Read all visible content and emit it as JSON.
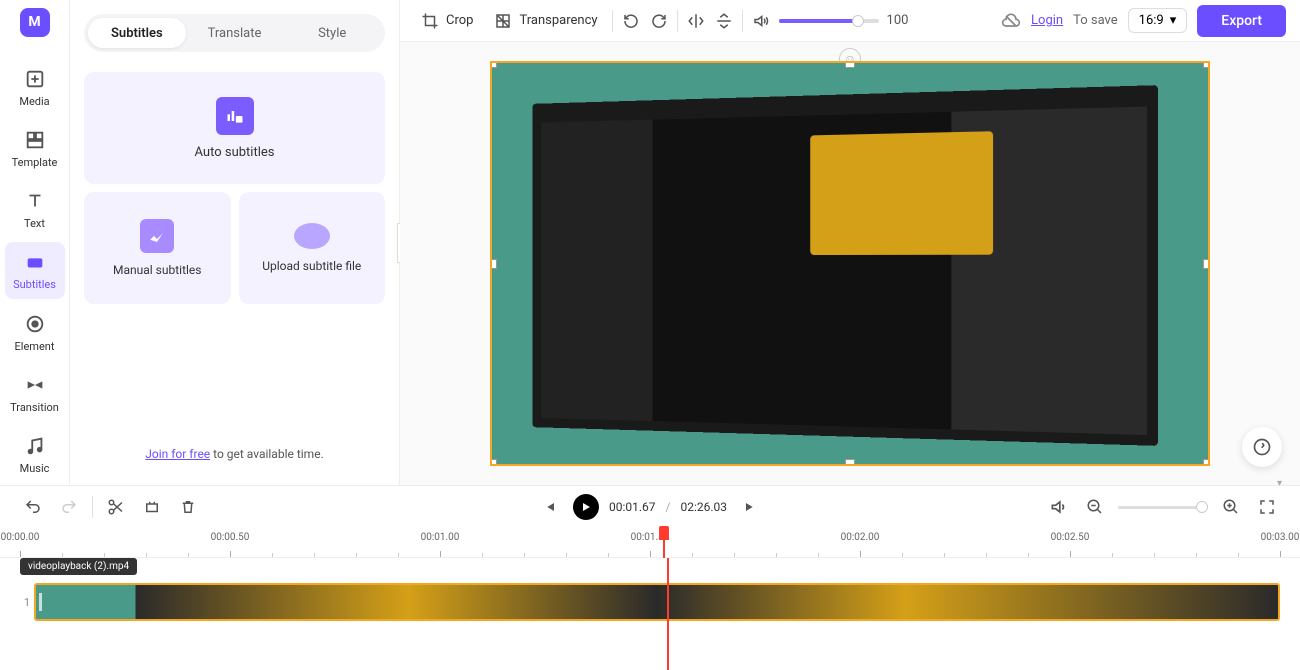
{
  "sidebar": {
    "items": [
      {
        "label": "Media"
      },
      {
        "label": "Template"
      },
      {
        "label": "Text"
      },
      {
        "label": "Subtitles"
      },
      {
        "label": "Element"
      },
      {
        "label": "Transition"
      },
      {
        "label": "Music"
      }
    ]
  },
  "panel": {
    "tabs": [
      {
        "label": "Subtitles"
      },
      {
        "label": "Translate"
      },
      {
        "label": "Style"
      }
    ],
    "auto_label": "Auto subtitles",
    "manual_label": "Manual subtitles",
    "upload_label": "Upload subtitle file",
    "join_link": "Join for free",
    "join_rest": " to get available time."
  },
  "toolbar": {
    "crop": "Crop",
    "transparency": "Transparency",
    "volume": "100",
    "login": "Login",
    "to_save": "To save",
    "ratio": "16:9",
    "export": "Export"
  },
  "playback": {
    "current": "00:01.67",
    "separator": "/",
    "total": "02:26.03"
  },
  "ruler": {
    "labels": [
      "00:00.00",
      "00:00.50",
      "00:01.00",
      "00:01.50",
      "00:02.00",
      "00:02.50",
      "00:03.00"
    ]
  },
  "timeline": {
    "clip_name": "videoplayback (2).mp4",
    "track_num": "1"
  }
}
